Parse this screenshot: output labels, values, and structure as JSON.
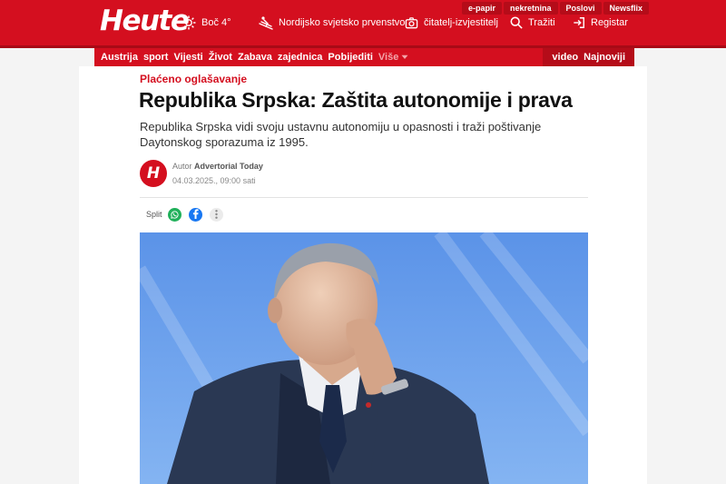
{
  "header": {
    "logo": "Heute",
    "weather": {
      "city": "Boč",
      "temperature": "4°"
    },
    "nordisk_label": "Nordijsko svjetsko prvenstvo",
    "reporter_label": "čitatelj-izvjestitelj",
    "search_label": "Tražiti",
    "register_label": "Registar",
    "portal_links": [
      "e-papir",
      "nekretnina",
      "Poslovi",
      "Newsflix"
    ]
  },
  "nav": {
    "items": [
      "Austrija",
      "sport",
      "Vijesti",
      "Život",
      "Zabava",
      "zajednica",
      "Pobijediti"
    ],
    "more_label": "Više",
    "right_items": [
      "video",
      "Najnoviji"
    ]
  },
  "article": {
    "sponsored_label": "Plaćeno oglašavanje",
    "headline": "Republika Srpska: Zaštita autonomije i prava",
    "lead": "Republika Srpska vidi svoju ustavnu autonomiju u opasnosti i traži poštivanje Daytonskog sporazuma iz 1995.",
    "author_prefix": "Autor",
    "author_name": "Advertorial Today",
    "date": "04.03.2025., 09:00 sati",
    "avatar_letter": "H",
    "share_label": "Split"
  },
  "colors": {
    "brand": "#d40f1f",
    "brand_dark": "#b50c19",
    "whatsapp": "#20b05a",
    "facebook": "#1877f2"
  },
  "icons": [
    "sun-icon",
    "ski-jumper-icon",
    "camera-icon",
    "search-icon",
    "login-icon",
    "chevron-down-icon",
    "whatsapp-icon",
    "facebook-icon",
    "more-vertical-icon"
  ]
}
